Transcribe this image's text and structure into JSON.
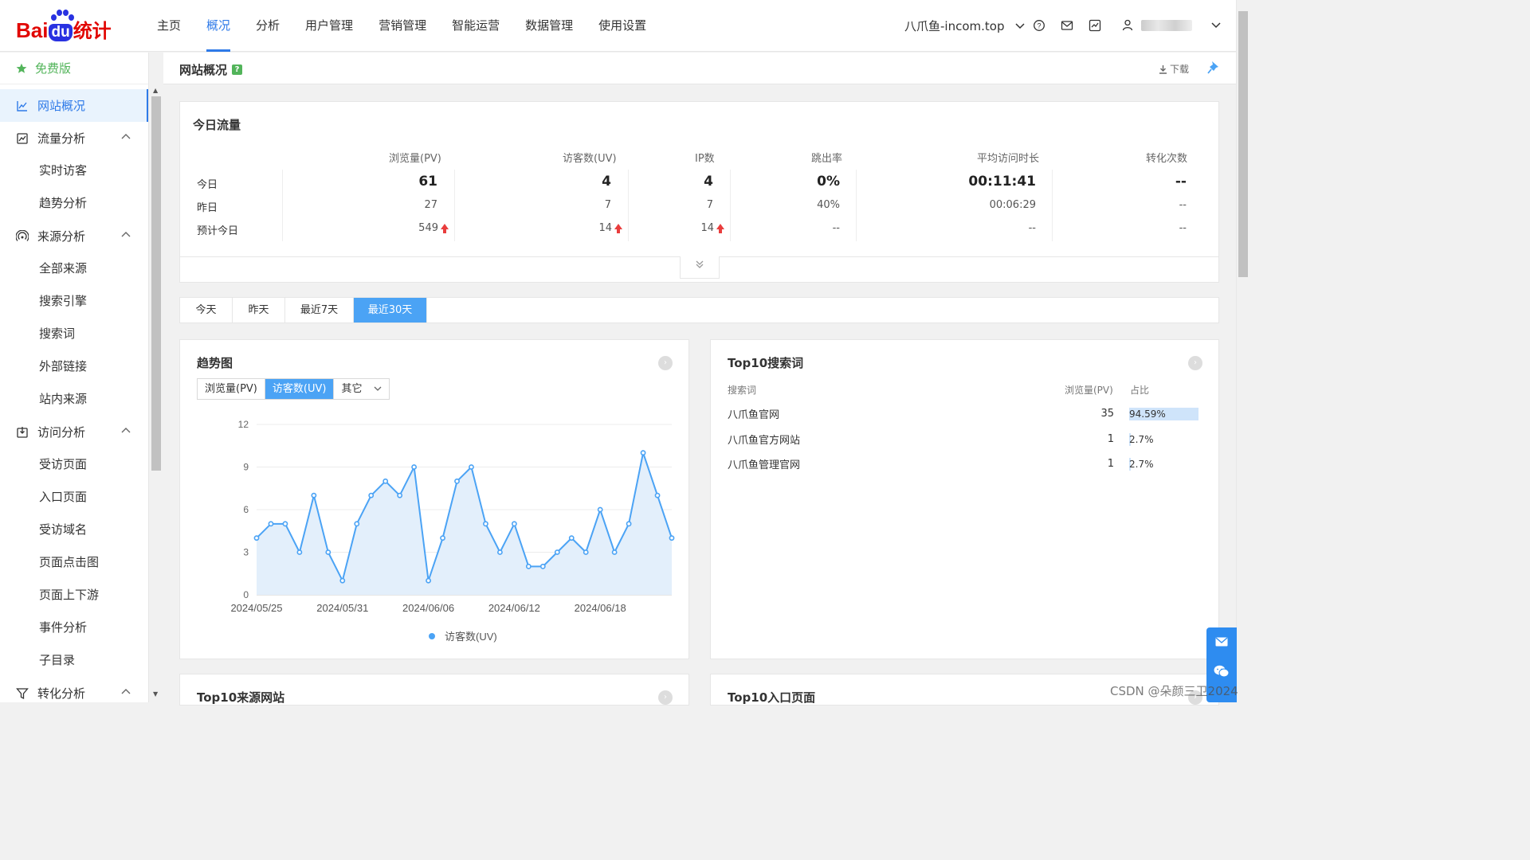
{
  "brand": {
    "bai": "Bai",
    "du": "du",
    "tj": "统计"
  },
  "nav": [
    "主页",
    "概况",
    "分析",
    "用户管理",
    "营销管理",
    "智能运营",
    "数据管理",
    "使用设置"
  ],
  "site": "八爪鱼-incom.top",
  "edition": "免费版",
  "sidebar": {
    "overview": "网站概况",
    "traffic": {
      "label": "流量分析",
      "items": [
        "实时访客",
        "趋势分析"
      ]
    },
    "source": {
      "label": "来源分析",
      "items": [
        "全部来源",
        "搜索引擎",
        "搜索词",
        "外部链接",
        "站内来源"
      ]
    },
    "visit": {
      "label": "访问分析",
      "items": [
        "受访页面",
        "入口页面",
        "受访域名",
        "页面点击图",
        "页面上下游",
        "事件分析",
        "子目录"
      ]
    },
    "conversion": "转化分析"
  },
  "header": {
    "title": "网站概况",
    "help": "?",
    "download": "下载"
  },
  "flow": {
    "title": "今日流量",
    "headers": [
      "浏览量(PV)",
      "访客数(UV)",
      "IP数",
      "跳出率",
      "平均访问时长",
      "转化次数"
    ],
    "rows": [
      {
        "label": "今日",
        "values": [
          "61",
          "4",
          "4",
          "0%",
          "00:11:41",
          "--"
        ]
      },
      {
        "label": "昨日",
        "values": [
          "27",
          "7",
          "7",
          "40%",
          "00:06:29",
          "--"
        ]
      },
      {
        "label": "预计今日",
        "values": [
          "549",
          "14",
          "14",
          "--",
          "--",
          "--"
        ]
      }
    ]
  },
  "periods": [
    "今天",
    "昨天",
    "最近7天",
    "最近30天"
  ],
  "trend": {
    "title": "趋势图",
    "metrics": [
      "浏览量(PV)",
      "访客数(UV)",
      "其它"
    ],
    "legend": "访客数(UV)"
  },
  "chart_data": {
    "type": "line",
    "title": "趋势图",
    "x": [
      "2024/05/25",
      "2024/05/26",
      "2024/05/27",
      "2024/05/28",
      "2024/05/29",
      "2024/05/30",
      "2024/05/31",
      "2024/06/01",
      "2024/06/02",
      "2024/06/03",
      "2024/06/04",
      "2024/06/05",
      "2024/06/06",
      "2024/06/07",
      "2024/06/08",
      "2024/06/09",
      "2024/06/10",
      "2024/06/11",
      "2024/06/12",
      "2024/06/13",
      "2024/06/14",
      "2024/06/15",
      "2024/06/16",
      "2024/06/17",
      "2024/06/18",
      "2024/06/19",
      "2024/06/20",
      "2024/06/21",
      "2024/06/22",
      "2024/06/23"
    ],
    "x_tick_labels": [
      "2024/05/25",
      "2024/05/31",
      "2024/06/06",
      "2024/06/12",
      "2024/06/18"
    ],
    "series": [
      {
        "name": "访客数(UV)",
        "values": [
          4,
          5,
          5,
          3,
          7,
          3,
          1,
          5,
          7,
          8,
          7,
          9,
          1,
          4,
          8,
          9,
          5,
          3,
          5,
          2,
          2,
          3,
          4,
          3,
          6,
          3,
          5,
          10,
          7,
          4
        ],
        "color": "#4ba3f5"
      }
    ],
    "ylim": [
      0,
      12
    ],
    "yticks": [
      0,
      3,
      6,
      9,
      12
    ],
    "grid": true,
    "legend_position": "bottom"
  },
  "search": {
    "title": "Top10搜索词",
    "headers": [
      "搜索词",
      "浏览量(PV)",
      "占比"
    ],
    "rows": [
      {
        "word": "八爪鱼官网",
        "pv": "35",
        "pct": "94.59%",
        "ratio": 0.9459
      },
      {
        "word": "八爪鱼官方网站",
        "pv": "1",
        "pct": "2.7%",
        "ratio": 0.027
      },
      {
        "word": "八爪鱼管理官网",
        "pv": "1",
        "pct": "2.7%",
        "ratio": 0.027
      }
    ]
  },
  "bottom": {
    "left_title": "Top10来源网站",
    "right_title": "Top10入口页面"
  },
  "watermark": "CSDN @朵颜三卫2024"
}
